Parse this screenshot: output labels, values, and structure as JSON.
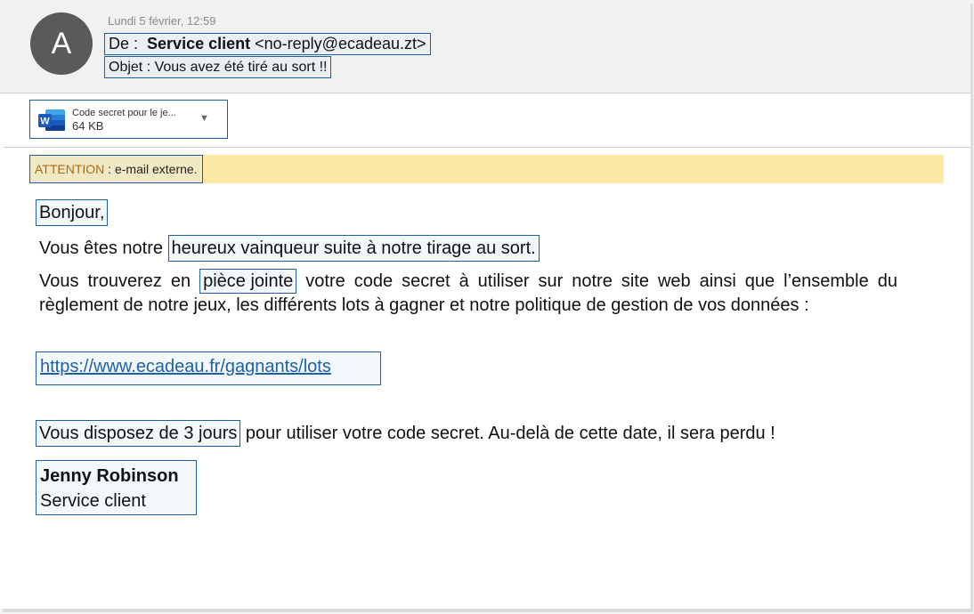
{
  "email": {
    "avatar_letter": "A",
    "date": "Lundi 5 février, 12:59",
    "from_prefix": "De :",
    "from_name": "Service client",
    "from_address": "<no-reply@ecadeau.zt>",
    "subject_prefix": "Objet :",
    "subject": "Vous avez été tiré au sort !!"
  },
  "attachment": {
    "name": "Code secret pour le je...",
    "size": "64 KB",
    "icon": "word-icon",
    "icon_letter": "W",
    "caret": "▼"
  },
  "banner": {
    "label": "ATTENTION",
    "separator": " : ",
    "text": "e-mail externe."
  },
  "body": {
    "greeting": "Bonjour,",
    "line1_prefix": "Vous êtes notre ",
    "line1_highlight": "heureux vainqueur suite à notre tirage au sort.",
    "para_prefix": "Vous trouverez en ",
    "para_highlight": "pièce jointe",
    "para_rest": " votre code secret à utiliser sur notre site web ainsi que l’ensemble du règlement de notre jeux, les différents lots à gagner et notre politique de gestion de vos données :",
    "link": "https://www.ecadeau.fr/gagnants/lots",
    "deadline_highlight": "Vous disposez de 3 jours",
    "deadline_rest": " pour utiliser votre code secret. Au-delà de cette date, il sera perdu !"
  },
  "signature": {
    "name": "Jenny Robinson",
    "role": "Service client"
  },
  "colors": {
    "highlight_border": "#1f5fa8",
    "banner_bg": "#fce9a6",
    "banner_label": "#a9691a",
    "word_blue": "#185abd"
  }
}
